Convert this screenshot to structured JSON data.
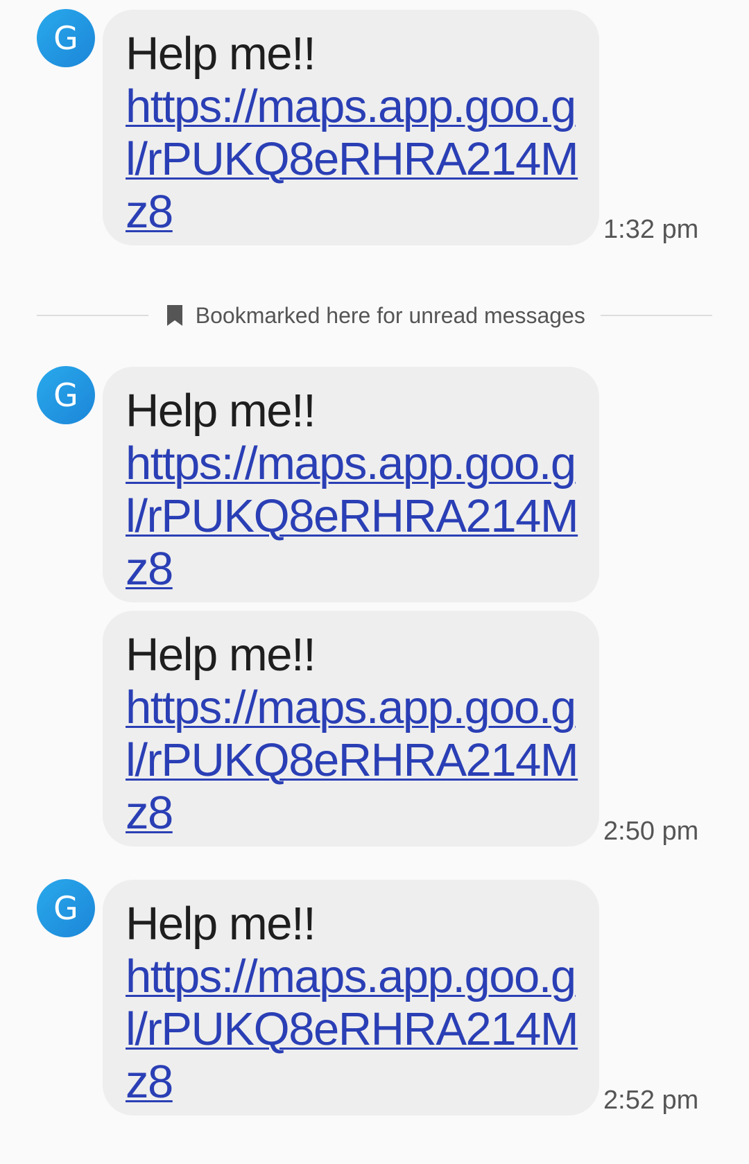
{
  "conversation": {
    "avatar_letter": "G",
    "divider_label": "Bookmarked here for unread messages",
    "messages": [
      {
        "text": "Help me!!",
        "link": "https://maps.app.goo.gl/rPUKQ8eRHRA214Mz8",
        "time": "1:32 pm"
      },
      {
        "text": "Help me!!",
        "link": "https://maps.app.goo.gl/rPUKQ8eRHRA214Mz8",
        "time": ""
      },
      {
        "text": "Help me!!",
        "link": "https://maps.app.goo.gl/rPUKQ8eRHRA214Mz8",
        "time": "2:50 pm"
      },
      {
        "text": "Help me!!",
        "link": "https://maps.app.goo.gl/rPUKQ8eRHRA214Mz8",
        "time": "2:52 pm"
      }
    ]
  },
  "colors": {
    "avatar": "#1c86d8",
    "bubble": "#eeeeee",
    "link": "#2a3fb5",
    "background": "#fafafa"
  },
  "icons": {
    "bookmark": "bookmark-icon"
  }
}
